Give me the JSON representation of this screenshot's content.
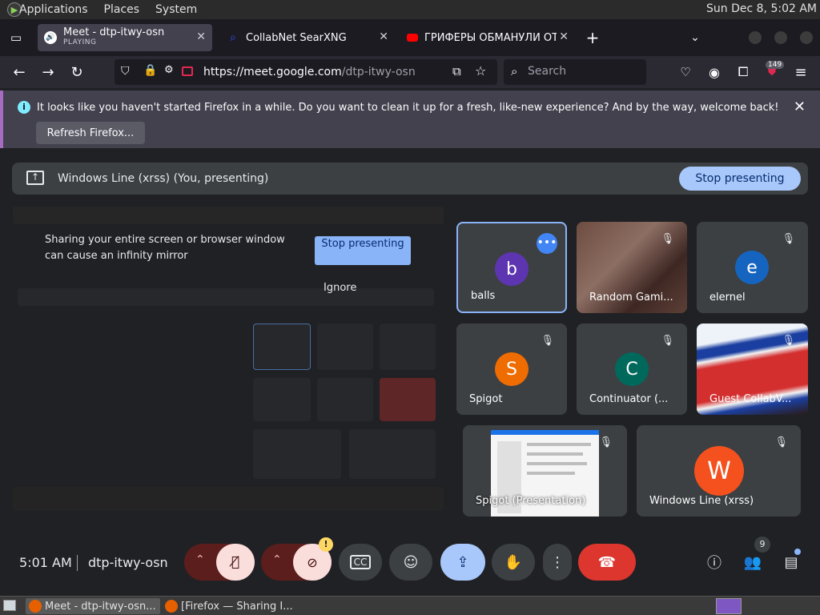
{
  "os": {
    "menus": [
      "Applications",
      "Places",
      "System"
    ],
    "clock": "Sun Dec  8,  5:02 AM"
  },
  "browser": {
    "tabs": [
      {
        "title": "Meet - dtp-itwy-osn",
        "status": "PLAYING",
        "active": true
      },
      {
        "title": "CollabNet SearXNG",
        "active": false
      },
      {
        "title": "ГРИФЕРЫ ОБМАНУЛИ ОТ",
        "active": false
      }
    ],
    "new_tab": "+",
    "url_host": "https://meet.google.com",
    "url_path": "/dtp-itwy-osn",
    "search_placeholder": "Search",
    "ext_badge": "149"
  },
  "notice": {
    "text": "It looks like you haven't started Firefox in a while. Do you want to clean it up for a fresh, like-new experience? And by the way, welcome back!",
    "button": "Refresh Firefox..."
  },
  "meet": {
    "presenting_title": "Windows Line (xrss) (You, presenting)",
    "stop_presenting": "Stop presenting",
    "mirror_message": "Sharing your entire screen or browser window can cause an infinity mirror",
    "mirror_stop": "Stop presenting",
    "mirror_ignore": "Ignore",
    "participants": [
      {
        "name": "balls",
        "initial": "b",
        "color": "#5e35b1"
      },
      {
        "name": "Random Gami...",
        "initial": "",
        "color": ""
      },
      {
        "name": "elernel",
        "initial": "e",
        "color": "#1565c0"
      },
      {
        "name": "Spigot",
        "initial": "S",
        "color": "#ef6c00"
      },
      {
        "name": "Continuator (...",
        "initial": "C",
        "color": "#00695c"
      },
      {
        "name": "Guest CollabV...",
        "initial": "",
        "color": ""
      },
      {
        "name": "Spigot (Presentation)",
        "initial": "",
        "color": ""
      },
      {
        "name": "Windows Line (xrss)",
        "initial": "W",
        "color": "#f4511e"
      }
    ],
    "clock": "5:01 AM",
    "meeting_code": "dtp-itwy-osn",
    "people_count": "9",
    "camera_alert": "!"
  },
  "taskbar": {
    "items": [
      "Meet - dtp-itwy-osn...",
      "[Firefox — Sharing I..."
    ]
  }
}
